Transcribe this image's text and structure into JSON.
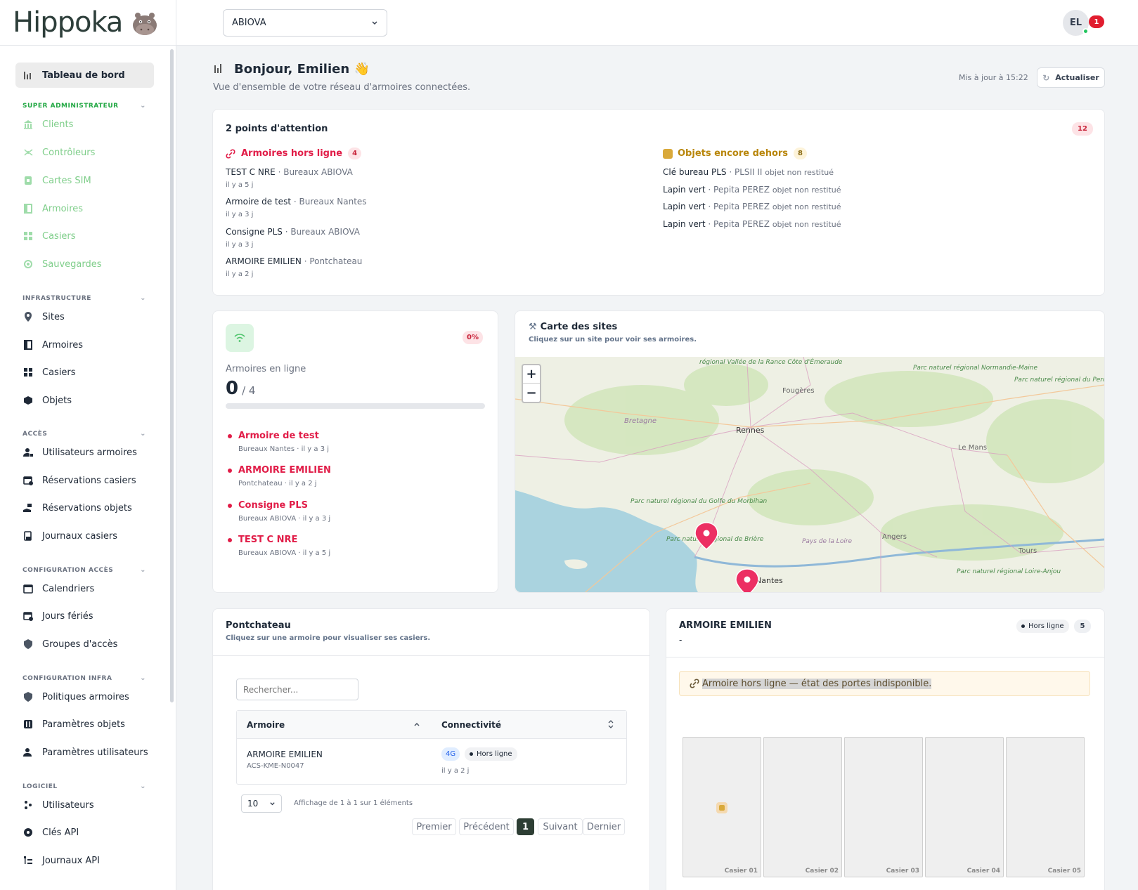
{
  "app": {
    "name": "Hippoka"
  },
  "header": {
    "client_select": "ABIOVA",
    "user_initials": "EL",
    "notification_count": "1"
  },
  "sidebar": {
    "active": "Tableau de bord",
    "sections": [
      {
        "title": "SUPER ADMINISTRATEUR",
        "items": [
          "Clients",
          "Contrôleurs",
          "Cartes SIM",
          "Armoires",
          "Casiers",
          "Sauvegardes"
        ]
      },
      {
        "title": "INFRASTRUCTURE",
        "items": [
          "Sites",
          "Armoires",
          "Casiers",
          "Objets"
        ]
      },
      {
        "title": "ACCÈS",
        "items": [
          "Utilisateurs armoires",
          "Réservations casiers",
          "Réservations objets",
          "Journaux casiers"
        ]
      },
      {
        "title": "CONFIGURATION ACCÈS",
        "items": [
          "Calendriers",
          "Jours fériés",
          "Groupes d'accès"
        ]
      },
      {
        "title": "CONFIGURATION INFRA",
        "items": [
          "Politiques armoires",
          "Paramètres objets",
          "Paramètres utilisateurs"
        ]
      },
      {
        "title": "LOGICIEL",
        "items": [
          "Utilisateurs",
          "Clés API",
          "Journaux API"
        ]
      }
    ]
  },
  "page": {
    "greeting": "Bonjour, Emilien",
    "subtitle": "Vue d'ensemble de votre réseau d'armoires connectées.",
    "updated": "Mis à jour à 15:22",
    "refresh": "Actualiser"
  },
  "attention": {
    "title": "2 points d'attention",
    "total": "12",
    "offline": {
      "title": "Armoires hors ligne",
      "count": "4",
      "items": [
        {
          "name": "TEST C NRE",
          "site": "· Bureaux ABIOVA",
          "time": "il y a 5 j"
        },
        {
          "name": "Armoire de test",
          "site": "· Bureaux Nantes",
          "time": "il y a 3 j"
        },
        {
          "name": "Consigne PLS",
          "site": "· Bureaux ABIOVA",
          "time": "il y a 3 j"
        },
        {
          "name": "ARMOIRE EMILIEN",
          "site": "· Pontchateau",
          "time": "il y a 2 j"
        }
      ]
    },
    "outside": {
      "title": "Objets encore dehors",
      "count": "8",
      "items": [
        {
          "name": "Clé bureau PLS",
          "who": "· PLSII II",
          "status": "objet non restitué"
        },
        {
          "name": "Lapin vert",
          "who": "· Pepita PEREZ",
          "status": "objet non restitué"
        },
        {
          "name": "Lapin vert",
          "who": "· Pepita PEREZ",
          "status": "objet non restitué"
        },
        {
          "name": "Lapin vert",
          "who": "· Pepita PEREZ",
          "status": "objet non restitué"
        }
      ]
    }
  },
  "online": {
    "percent": "0%",
    "label": "Armoires en ligne",
    "value": "0",
    "total": "/ 4",
    "progress": 0,
    "items": [
      {
        "name": "Armoire de test",
        "meta": "Bureaux Nantes · il y a 3 j"
      },
      {
        "name": "ARMOIRE EMILIEN",
        "meta": "Pontchateau · il y a 2 j"
      },
      {
        "name": "Consigne PLS",
        "meta": "Bureaux ABIOVA · il y a 3 j"
      },
      {
        "name": "TEST C NRE",
        "meta": "Bureaux ABIOVA · il y a 5 j"
      }
    ]
  },
  "map": {
    "title": "Carte des sites",
    "subtitle": "Cliquez sur un site pour voir ses armoires.",
    "zoom_in": "+",
    "zoom_out": "−",
    "labels": [
      "Fougères",
      "Rennes",
      "Bretagne",
      "Le Mans",
      "Angers",
      "Nantes",
      "Tours",
      "Pays de la Loire",
      "Parc naturel régional Normandie-Maine",
      "Parc naturel régional du Perche",
      "Parc naturel régional du Golfe du Morbihan",
      "Parc naturel régional de Brière",
      "Parc naturel régional Loire-Anjou",
      "régional Vallée de la Rance Côte d'Émeraude"
    ]
  },
  "site_panel": {
    "title": "Pontchateau",
    "subtitle": "Cliquez sur une armoire pour visualiser ses casiers.",
    "search_placeholder": "Rechercher...",
    "columns": [
      "Armoire",
      "Connectivité"
    ],
    "rows": [
      {
        "name": "ARMOIRE EMILIEN",
        "code": "ACS-KME-N0047",
        "network": "4G",
        "status": "Hors ligne",
        "time": "il y a 2 j"
      }
    ],
    "page_size": "10",
    "summary": "Affichage de 1 à 1 sur 1 éléments",
    "pagination": [
      "Premier",
      "Précédent",
      "1",
      "Suivant",
      "Dernier"
    ]
  },
  "cabinet_panel": {
    "title": "ARMOIRE EMILIEN",
    "subtitle": "-",
    "status": "Hors ligne",
    "count": "5",
    "alert": "Armoire hors ligne — état des portes indisponible.",
    "lockers": [
      "Casier 01",
      "Casier 02",
      "Casier 03",
      "Casier 04",
      "Casier 05"
    ]
  },
  "colors": {
    "accent": "#22a843",
    "danger": "#e11d48",
    "warning": "#b8860b"
  }
}
